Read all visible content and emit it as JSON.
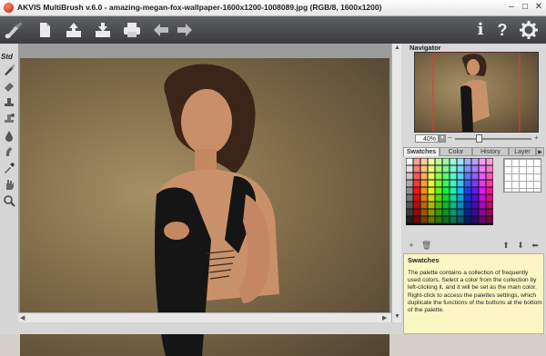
{
  "window": {
    "title": "AKVIS MultiBrush v.6.0 - amazing-megan-fox-wallpaper-1600x1200-1008089.jpg (RGB/8, 1600x1200)",
    "minimize": "–",
    "maximize": "□",
    "close": "✕"
  },
  "toolbar": {
    "left_icons": [
      "brush-logo-icon",
      "new-file-icon",
      "open-file-icon",
      "save-file-icon",
      "print-icon",
      "undo-icon",
      "redo-icon"
    ],
    "right_icons": [
      "info-icon",
      "help-icon",
      "settings-icon"
    ],
    "info": "i",
    "help": "?"
  },
  "tools": {
    "mode_label": "Std",
    "items": [
      "brush-icon",
      "eraser-icon",
      "clone-stamp-icon",
      "healing-icon",
      "blur-icon",
      "smudge-icon",
      "eyedropper-icon",
      "hand-icon",
      "zoom-icon"
    ]
  },
  "navigator": {
    "title": "Navigator",
    "zoom_value": "40%",
    "zoom_minus": "−",
    "zoom_plus": "+"
  },
  "palette": {
    "tabs": [
      "Swatches",
      "Color",
      "History",
      "Layer"
    ],
    "active_tab": "Swatches",
    "buttons": [
      "add-swatch-icon",
      "delete-swatch-icon",
      "load-palette-icon",
      "save-palette-icon",
      "reset-palette-icon"
    ]
  },
  "help": {
    "title": "Swatches",
    "text": "The palette contains a collection of frequently used colors. Select a color from the collection by left-clicking it, and it will be set as the main color. Right-click to access the palettes settings, which duplicate the functions of the buttons at the bottom of the palette."
  },
  "colors": {
    "toolbar_bg": "#4a4b4e",
    "help_bg": "#fbf6c4",
    "photo_bg": "#806c48"
  }
}
